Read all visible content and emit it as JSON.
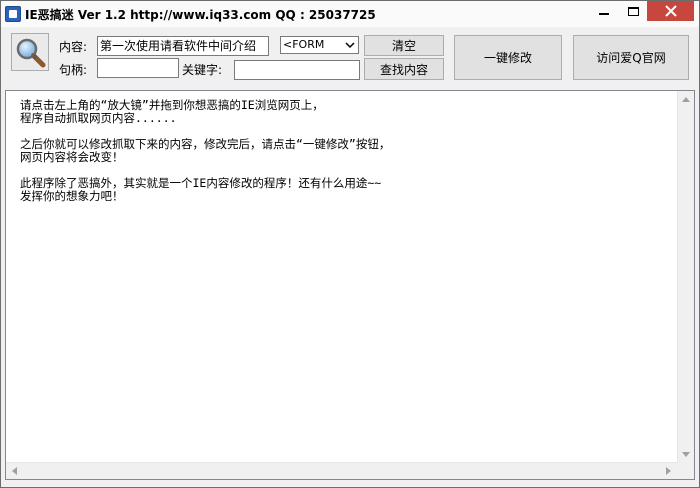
{
  "window": {
    "title": "IE恶搞迷 Ver 1.2 http://www.iq33.com QQ : 25037725",
    "icons": {
      "app": "app-icon",
      "minimize": "minimize-icon",
      "maximize": "maximize-icon",
      "close": "close-icon"
    },
    "close_color": "#c7463d"
  },
  "toolbar": {
    "magnifier_icon": "magnifier-icon",
    "content_label": "内容:",
    "content_value": "第一次使用请看软件中间介绍",
    "handle_label": "句柄:",
    "handle_value": "",
    "keyword_label": "关键字:",
    "keyword_value": "",
    "tag_select": {
      "selected": "<FORM"
    },
    "clear_button": "清空",
    "find_button": "查找内容",
    "one_key_button": "一键修改",
    "visit_button": "访问爱Q官网"
  },
  "main": {
    "paragraphs": [
      [
        "请点击左上角的“放大镜”并拖到你想恶搞的IE浏览网页上，",
        "程序自动抓取网页内容......"
      ],
      [
        "之后你就可以修改抓取下来的内容，修改完后，请点击“一键修改”按钮，",
        "网页内容将会改变！"
      ],
      [
        "此程序除了恶搞外，其实就是一个IE内容修改的程序！还有什么用途~~",
        "发挥你的想象力吧！"
      ]
    ]
  }
}
